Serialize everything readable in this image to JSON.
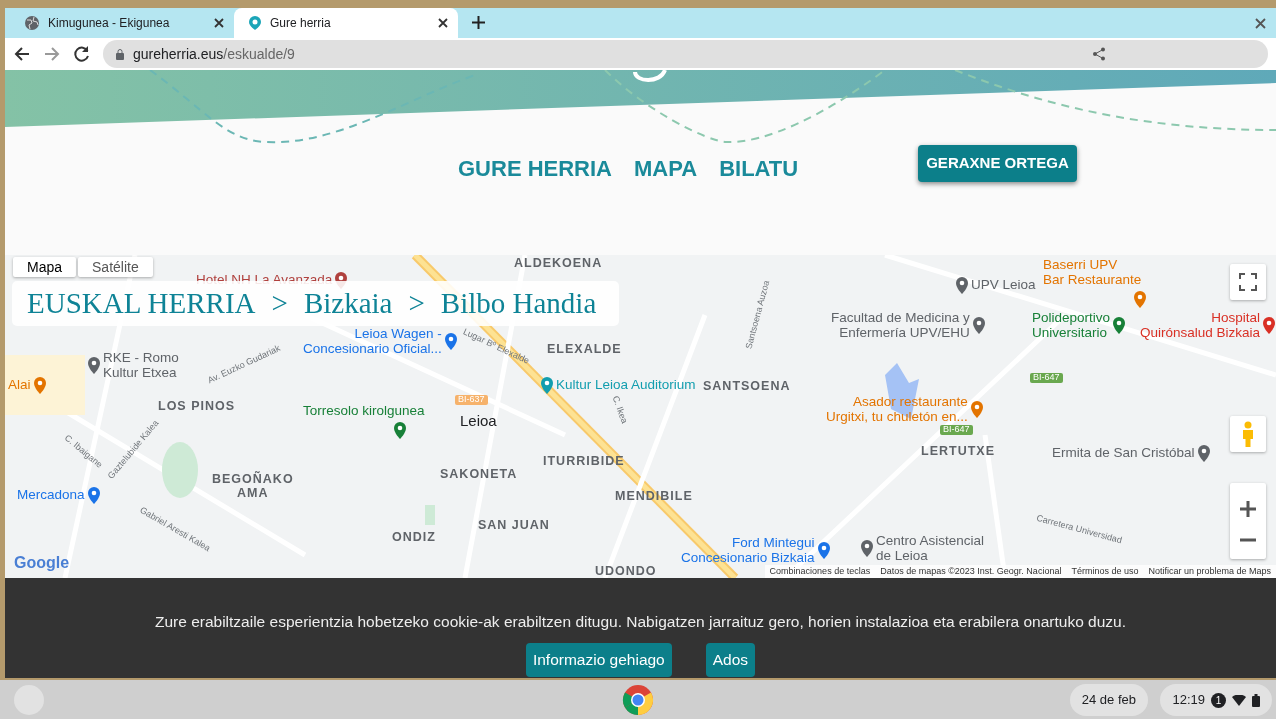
{
  "browser": {
    "tabs": [
      {
        "title": "Kimugunea - Ekigunea",
        "selected": false
      },
      {
        "title": "Gure herria",
        "selected": true
      }
    ],
    "url": {
      "host": "gureherria.eus",
      "path": "/eskualde/9"
    }
  },
  "site_nav": {
    "links": [
      "GURE HERRIA",
      "MAPA",
      "BILATU"
    ],
    "user_button": "GERAXNE ORTEGA"
  },
  "map": {
    "type_tabs": [
      {
        "label": "Mapa",
        "selected": true
      },
      {
        "label": "Satélite",
        "selected": false
      }
    ],
    "breadcrumb": {
      "items": [
        "EUSKAL HERRIA",
        "Bizkaia",
        "Bilbo Handia"
      ],
      "separator": ">"
    },
    "labels": [
      {
        "text": "ALDEKOENA",
        "kind": "district"
      },
      {
        "text": "Hotel NH La Avanzada",
        "kind": "poi",
        "color": "#b0413e"
      },
      {
        "text": "Leioa Wagen -\nConcesionario Oficial...",
        "kind": "poi",
        "color": "#1a73e8"
      },
      {
        "text": "ELEXALDE",
        "kind": "district"
      },
      {
        "text": "RKE - Romo\nKultur Etxea",
        "kind": "poi",
        "color": "#5f6368"
      },
      {
        "text": "Alai",
        "kind": "poi",
        "color": "#e37400"
      },
      {
        "text": "Kultur Leioa Auditorium",
        "kind": "poi",
        "color": "#129eaf"
      },
      {
        "text": "SANTSOENA",
        "kind": "district"
      },
      {
        "text": "LOS PINOS",
        "kind": "district"
      },
      {
        "text": "Torresolo kirolgunea",
        "kind": "poi",
        "color": "#188038"
      },
      {
        "text": "Leioa",
        "kind": "town"
      },
      {
        "text": "ITURRIBIDE",
        "kind": "district"
      },
      {
        "text": "SAKONETA",
        "kind": "district"
      },
      {
        "text": "Mercadona",
        "kind": "poi",
        "color": "#1a73e8"
      },
      {
        "text": "BEGOÑAKO\nAMA",
        "kind": "district"
      },
      {
        "text": "MENDIBILE",
        "kind": "district"
      },
      {
        "text": "SAN JUAN",
        "kind": "district"
      },
      {
        "text": "ONDIZ",
        "kind": "district"
      },
      {
        "text": "UDONDO",
        "kind": "district"
      },
      {
        "text": "Baserri UPV\nBar Restaurante",
        "kind": "poi",
        "color": "#e37400"
      },
      {
        "text": "UPV Leioa",
        "kind": "poi",
        "color": "#5f6368"
      },
      {
        "text": "Facultad de Medicina y\nEnfermería UPV/EHU",
        "kind": "poi",
        "color": "#5f6368"
      },
      {
        "text": "Polideportivo\nUniversitario",
        "kind": "poi",
        "color": "#188038"
      },
      {
        "text": "Hospital\nQuirónsalud Bizkaia",
        "kind": "poi",
        "color": "#d93025"
      },
      {
        "text": "Asador restaurante\nUrgitxi, tu chuletón en...",
        "kind": "poi",
        "color": "#e37400"
      },
      {
        "text": "LERTUTXE",
        "kind": "district"
      },
      {
        "text": "Ermita de San Cristóbal",
        "kind": "poi",
        "color": "#5f6368"
      },
      {
        "text": "Ford Mintegui\nConcesionario Bizkaia",
        "kind": "poi",
        "color": "#1a73e8"
      },
      {
        "text": "Centro Asistencial\nde Leioa",
        "kind": "poi",
        "color": "#5f6368"
      },
      {
        "text": "Av. Euzko Gudariak",
        "kind": "street"
      },
      {
        "text": "Gaztelubide Kalea",
        "kind": "street"
      },
      {
        "text": "C. Ibaigane",
        "kind": "street"
      },
      {
        "text": "Gabriel Aresti Kalea",
        "kind": "street"
      },
      {
        "text": "Lugar Bº Elexalde",
        "kind": "street"
      },
      {
        "text": "Santsoena Auzoa",
        "kind": "street"
      },
      {
        "text": "C. Ikea",
        "kind": "street"
      },
      {
        "text": "Carretera Universidad",
        "kind": "street"
      },
      {
        "text": "BI-637",
        "kind": "road",
        "color": "#f6b26b"
      },
      {
        "text": "BI-647",
        "kind": "road",
        "color": "#6aa84f"
      },
      {
        "text": "BI-647",
        "kind": "road",
        "color": "#6aa84f"
      }
    ],
    "logo": "Google",
    "attribution": [
      "Combinaciones de teclas",
      "Datos de mapas ©2023 Inst. Geogr. Nacional",
      "Términos de uso",
      "Notificar un problema de Maps"
    ]
  },
  "cookie_banner": {
    "message": "Zure erabiltzaile esperientzia hobetzeko cookie-ak erabiltzen ditugu. Nabigatzen jarraituz gero, horien instalazioa eta erabilera onartuko duzu.",
    "buttons": [
      "Informazio gehiago",
      "Ados"
    ]
  },
  "taskbar": {
    "date": "24 de feb",
    "time": "12:19",
    "notification_count": "1"
  }
}
